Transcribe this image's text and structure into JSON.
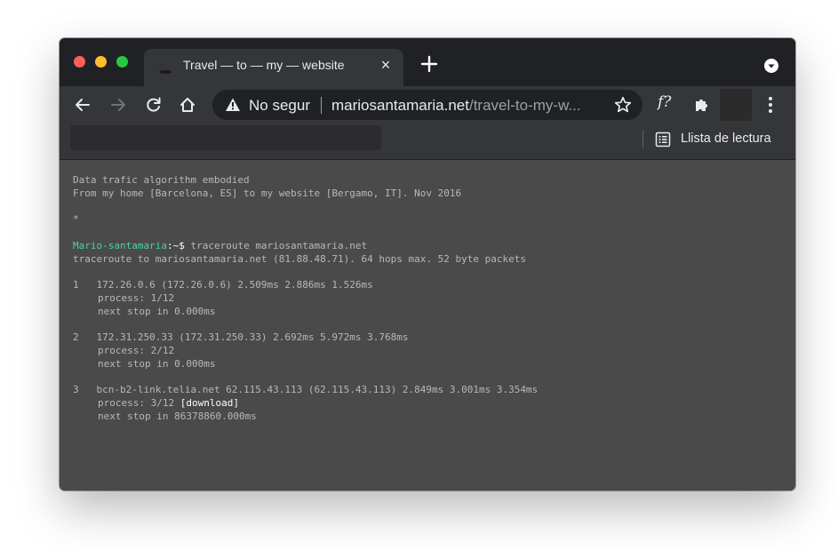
{
  "tab": {
    "title": "Travel — to — my — website",
    "close": "×"
  },
  "omnibox": {
    "security_label": "No segur",
    "url_host": "mariosantamaria.net",
    "url_path": "/travel-to-my-w..."
  },
  "extensions": {
    "f_label": "f?"
  },
  "bookmarks_bar": {
    "reading_list_label": "Llista de lectura"
  },
  "page": {
    "header_line1": "Data trafic algorithm embodied",
    "header_line2": "From my home [Barcelona, ES] to my website [Bergamo, IT]. Nov 2016",
    "asterisk": "*",
    "prompt_user": "Mario-santamaria",
    "prompt_sep": ":~$",
    "command": " traceroute mariosantamaria.net",
    "traceroute_header": "traceroute to mariosantamaria.net (81.88.48.71). 64 hops max. 52 byte packets",
    "hops": [
      {
        "line": "1   172.26.0.6 (172.26.0.6) 2.509ms 2.886ms 1.526ms",
        "process": "process: 1/12",
        "next": "next stop in 0.000ms"
      },
      {
        "line": "2   172.31.250.33 (172.31.250.33) 2.692ms 5.972ms 3.768ms",
        "process": "process: 2/12",
        "next": "next stop in 0.000ms"
      },
      {
        "line": "3   bcn-b2-link.telia.net 62.115.43.113 (62.115.43.113) 2.849ms 3.001ms 3.354ms",
        "process": "process: 3/12",
        "download": " [download]",
        "next": "next stop in 86378860.000ms"
      }
    ]
  },
  "colors": {
    "prompt_user": "#4fd1a8",
    "terminal_text": "#b8b8b8",
    "page_background": "#4a4a4a"
  }
}
